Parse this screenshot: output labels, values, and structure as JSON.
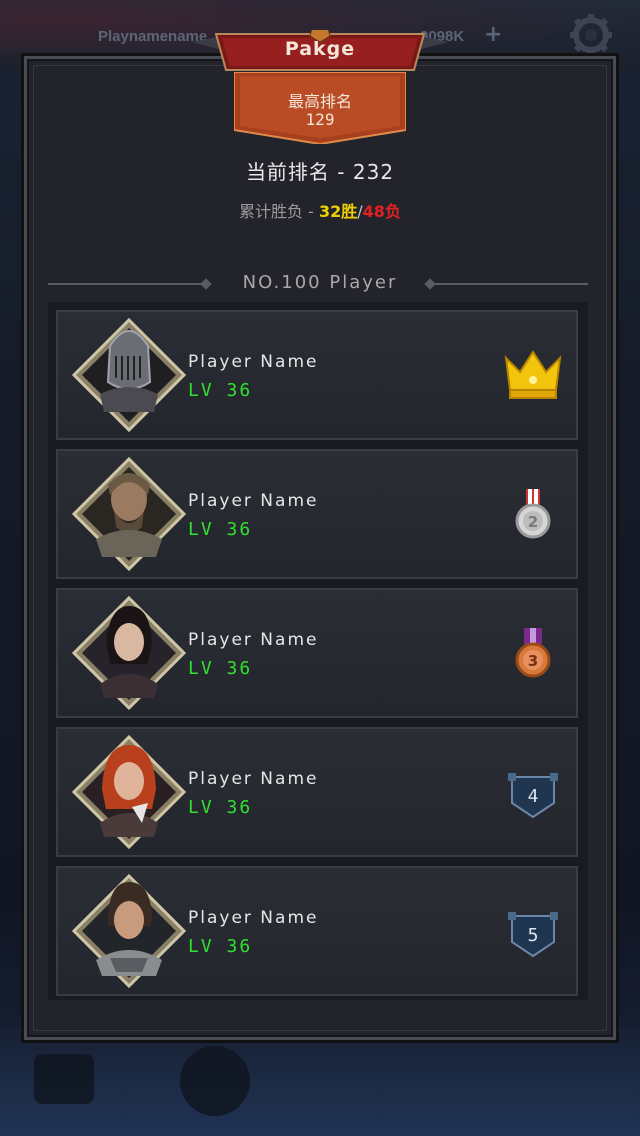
{
  "topbar": {
    "player_name": "Playnamename",
    "currency": "9098K",
    "plus_label": "+"
  },
  "title": "Pakge",
  "best_rank": {
    "label": "最高排名",
    "value": "129"
  },
  "current_rank": {
    "text": "当前排名 - 232"
  },
  "record": {
    "label": "累计胜负 - ",
    "wins": "32胜",
    "slash": "/",
    "losses": "48负"
  },
  "list_header": "NO.100 Player",
  "players": [
    {
      "name": "Player Name",
      "level": "LV 36",
      "rank": "1",
      "badge": "crown-icon"
    },
    {
      "name": "Player Name",
      "level": "LV 36",
      "rank": "2",
      "badge": "silver-medal-icon"
    },
    {
      "name": "Player Name",
      "level": "LV 36",
      "rank": "3",
      "badge": "bronze-medal-icon"
    },
    {
      "name": "Player Name",
      "level": "LV 36",
      "rank": "4",
      "badge": "rank-shield-icon"
    },
    {
      "name": "Player Name",
      "level": "LV 36",
      "rank": "5",
      "badge": "rank-shield-icon"
    }
  ],
  "colors": {
    "wins": "#f0d000",
    "losses": "#e42020",
    "level": "#2fe02f",
    "banner": "#8a1d1d",
    "ribbon": "#b44a2a"
  }
}
